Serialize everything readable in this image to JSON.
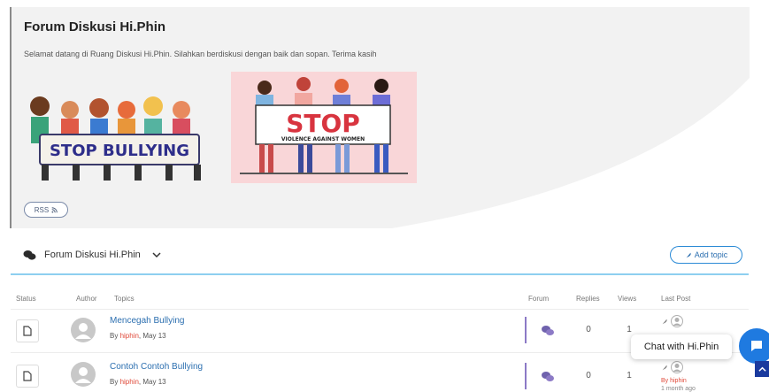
{
  "header": {
    "title": "Forum Diskusi Hi.Phin",
    "description": "Selamat datang di Ruang Diskusi Hi.Phin. Silahkan berdiskusi dengan baik dan sopan. Terima kasih",
    "banner_left_text": "STOP BULLYING",
    "banner_right_text": "STOP",
    "banner_right_sub": "VIOLENCE AGAINST WOMEN",
    "rss_label": "RSS"
  },
  "forum_bar": {
    "title": "Forum Diskusi Hi.Phin",
    "add_topic_label": "Add topic"
  },
  "table": {
    "columns": [
      "Status",
      "Author",
      "Topics",
      "Forum",
      "Replies",
      "Views",
      "Last Post"
    ],
    "rows": [
      {
        "title": "Mencegah Bullying",
        "by_prefix": "By ",
        "author": "hiphin",
        "date": ", May 13",
        "replies": "0",
        "views": "1",
        "last_by": "",
        "last_sub": ""
      },
      {
        "title": "Contoh Contoh Bullying",
        "by_prefix": "By ",
        "author": "hiphin",
        "date": ", May 13",
        "replies": "0",
        "views": "1",
        "last_by": "By hiphin",
        "last_sub": "1 month ago"
      }
    ]
  },
  "chat": {
    "label": "Chat with Hi.Phin"
  },
  "colors": {
    "accent_blue": "#2c8bd6",
    "author_red": "#e04a3a",
    "chat_blue": "#1f7ae0",
    "forum_purple": "#8c7ac6"
  }
}
